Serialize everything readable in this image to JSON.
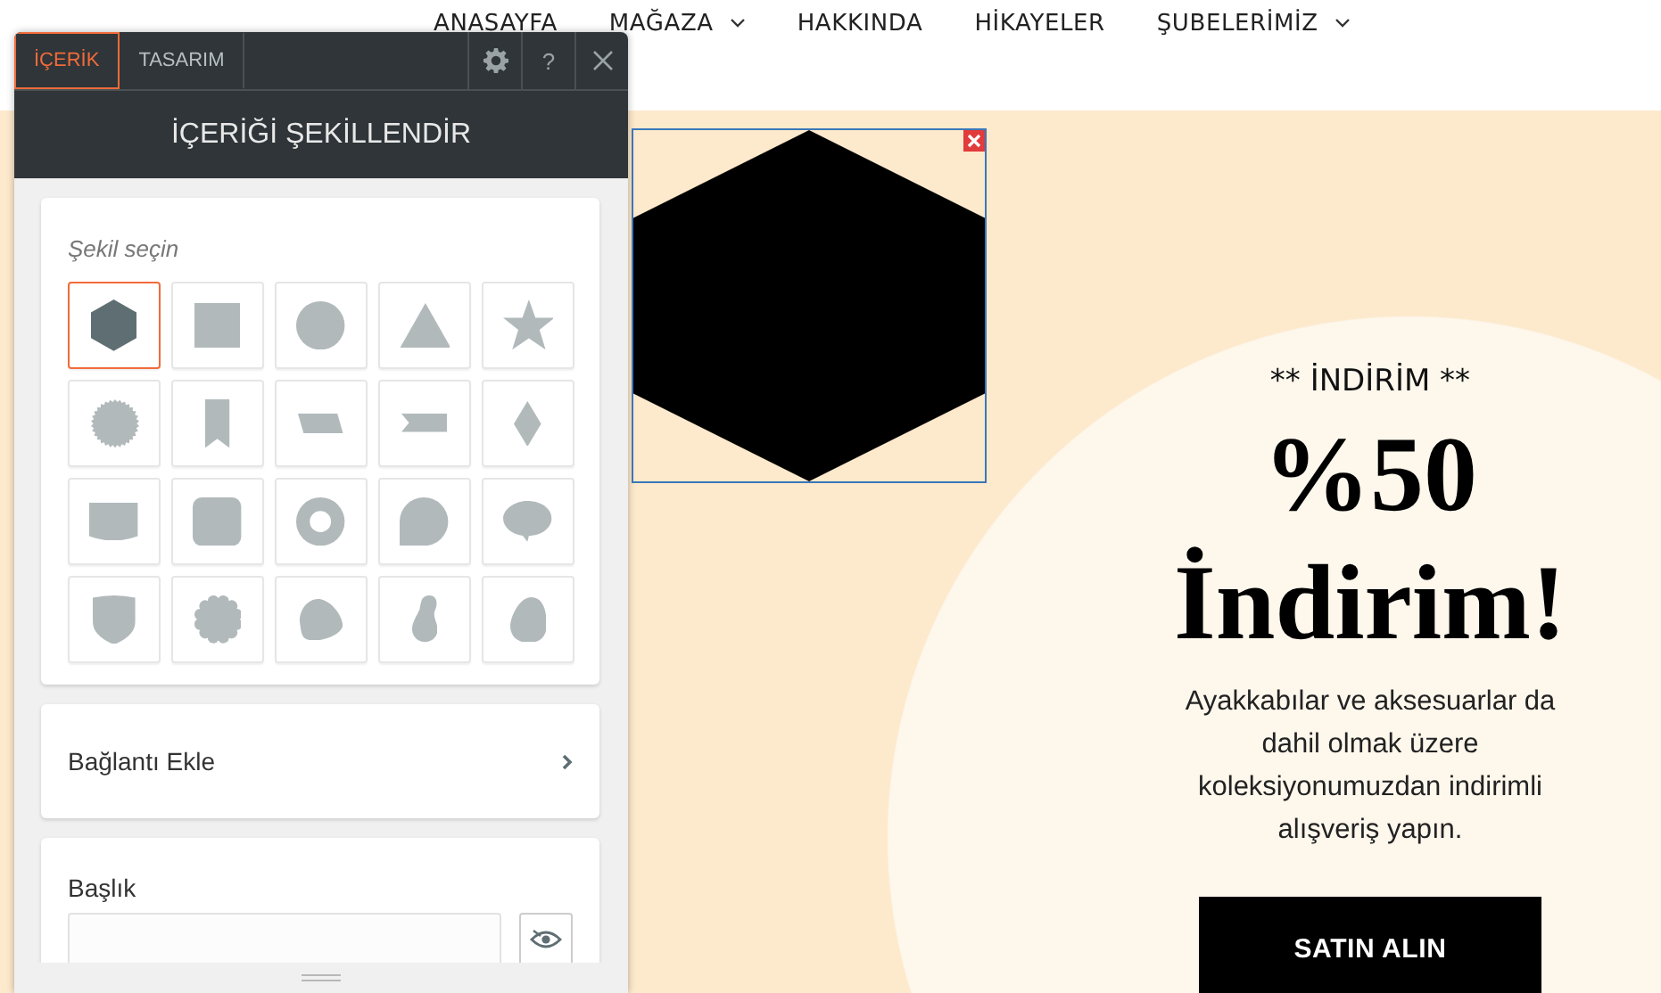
{
  "nav": [
    {
      "label": "ANASAYFA",
      "has_dropdown": false
    },
    {
      "label": "MAĞAZA",
      "has_dropdown": true
    },
    {
      "label": "HAKKINDA",
      "has_dropdown": false
    },
    {
      "label": "HİKAYELER",
      "has_dropdown": false
    },
    {
      "label": "ŞUBELERİMİZ",
      "has_dropdown": true
    }
  ],
  "editor_panel": {
    "tabs": [
      {
        "label": "İÇERİK",
        "selected": true
      },
      {
        "label": "TASARIM",
        "selected": false
      }
    ],
    "help_button": "?",
    "title": "İÇERİĞİ ŞEKİLLENDİR",
    "shape_picker": {
      "label": "Şekil seçin",
      "shapes": [
        {
          "kind": "hexagon",
          "selected": true
        },
        {
          "kind": "square",
          "selected": false
        },
        {
          "kind": "circle",
          "selected": false
        },
        {
          "kind": "triangle",
          "selected": false
        },
        {
          "kind": "star",
          "selected": false
        },
        {
          "kind": "seal",
          "selected": false
        },
        {
          "kind": "bookmark",
          "selected": false
        },
        {
          "kind": "parallelogram",
          "selected": false
        },
        {
          "kind": "ribbon",
          "selected": false
        },
        {
          "kind": "diamond",
          "selected": false
        },
        {
          "kind": "banner",
          "selected": false
        },
        {
          "kind": "rounded-square",
          "selected": false
        },
        {
          "kind": "ring",
          "selected": false
        },
        {
          "kind": "teardrop",
          "selected": false
        },
        {
          "kind": "speech-bubble",
          "selected": false
        },
        {
          "kind": "shield",
          "selected": false
        },
        {
          "kind": "scalloped",
          "selected": false
        },
        {
          "kind": "blob",
          "selected": false
        },
        {
          "kind": "bean",
          "selected": false
        },
        {
          "kind": "egg",
          "selected": false
        }
      ]
    },
    "link_row": {
      "label": "Bağlantı Ekle"
    },
    "title_field": {
      "label": "Başlık"
    }
  },
  "canvas": {
    "selected_shape": {
      "kind": "hexagon"
    }
  },
  "hero": {
    "eyebrow": "** İNDİRİM **",
    "headline_lines": [
      "%50",
      "İndirim!"
    ],
    "description": "Ayakkabılar ve aksesuarlar da dahil olmak üzere koleksiyonumuzdan indirimli alışveriş yapın.",
    "button": "SATIN ALIN"
  }
}
